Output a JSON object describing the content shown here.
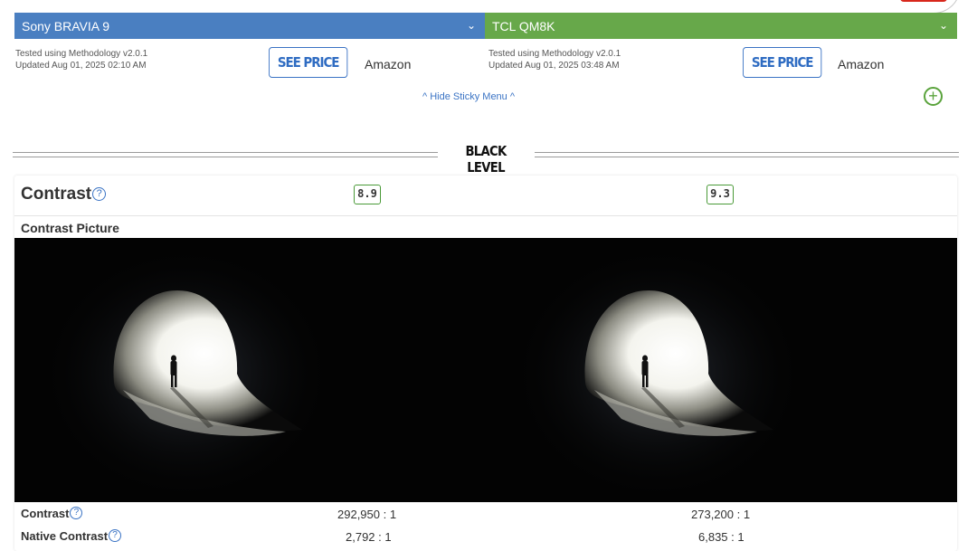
{
  "products": [
    {
      "name": "Sony BRAVIA 9",
      "meta_line1": "Tested using Methodology v2.0.1",
      "meta_line2": "Updated Aug 01, 2025 02:10 AM",
      "price_button": "SEE PRICE",
      "store": "Amazon",
      "color": "#4a7fc1"
    },
    {
      "name": "TCL QM8K",
      "meta_line1": "Tested using Methodology v2.0.1",
      "meta_line2": "Updated Aug 01, 2025 03:48 AM",
      "price_button": "SEE PRICE",
      "store": "Amazon",
      "color": "#67a84a"
    }
  ],
  "sticky_menu": {
    "hide_label": "^ Hide Sticky Menu ^"
  },
  "add_icon": "plus-circle-icon",
  "section": {
    "title": "BLACK LEVEL"
  },
  "contrast": {
    "title": "Contrast",
    "scores": [
      "8.9",
      "9.3"
    ],
    "picture_label": "Contrast Picture",
    "rows": [
      {
        "label": "Contrast",
        "values": [
          "292,950 : 1",
          "273,200 : 1"
        ]
      },
      {
        "label": "Native Contrast",
        "values": [
          "2,792 : 1",
          "6,835 : 1"
        ]
      }
    ]
  },
  "help_icon": "question-circle-icon",
  "chevron_icon": "chevron-down-icon"
}
